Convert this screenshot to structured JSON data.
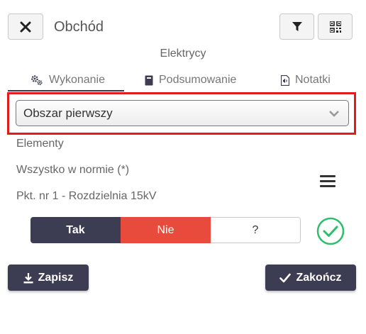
{
  "header": {
    "title": "Obchód",
    "subtitle": "Elektrycy"
  },
  "tabs": [
    {
      "label": "Wykonanie",
      "icon": "gears-icon",
      "active": true
    },
    {
      "label": "Podsumowanie",
      "icon": "book-icon",
      "active": false
    },
    {
      "label": "Notatki",
      "icon": "note-icon",
      "active": false
    }
  ],
  "area_select": {
    "value": "Obszar pierwszy"
  },
  "content": {
    "elements_label": "Elementy",
    "all_normal_label": "Wszystko w normie (*)",
    "point_label": "Pkt. nr 1 - Rozdzielnia 15kV"
  },
  "answer_options": {
    "yes": "Tak",
    "no": "Nie",
    "unknown": "?"
  },
  "footer": {
    "save_label": "Zapisz",
    "finish_label": "Zakończ"
  },
  "colors": {
    "primary": "#3c3c52",
    "danger": "#e84a3b",
    "success": "#2bbf6b",
    "highlight": "#e31b1b"
  }
}
